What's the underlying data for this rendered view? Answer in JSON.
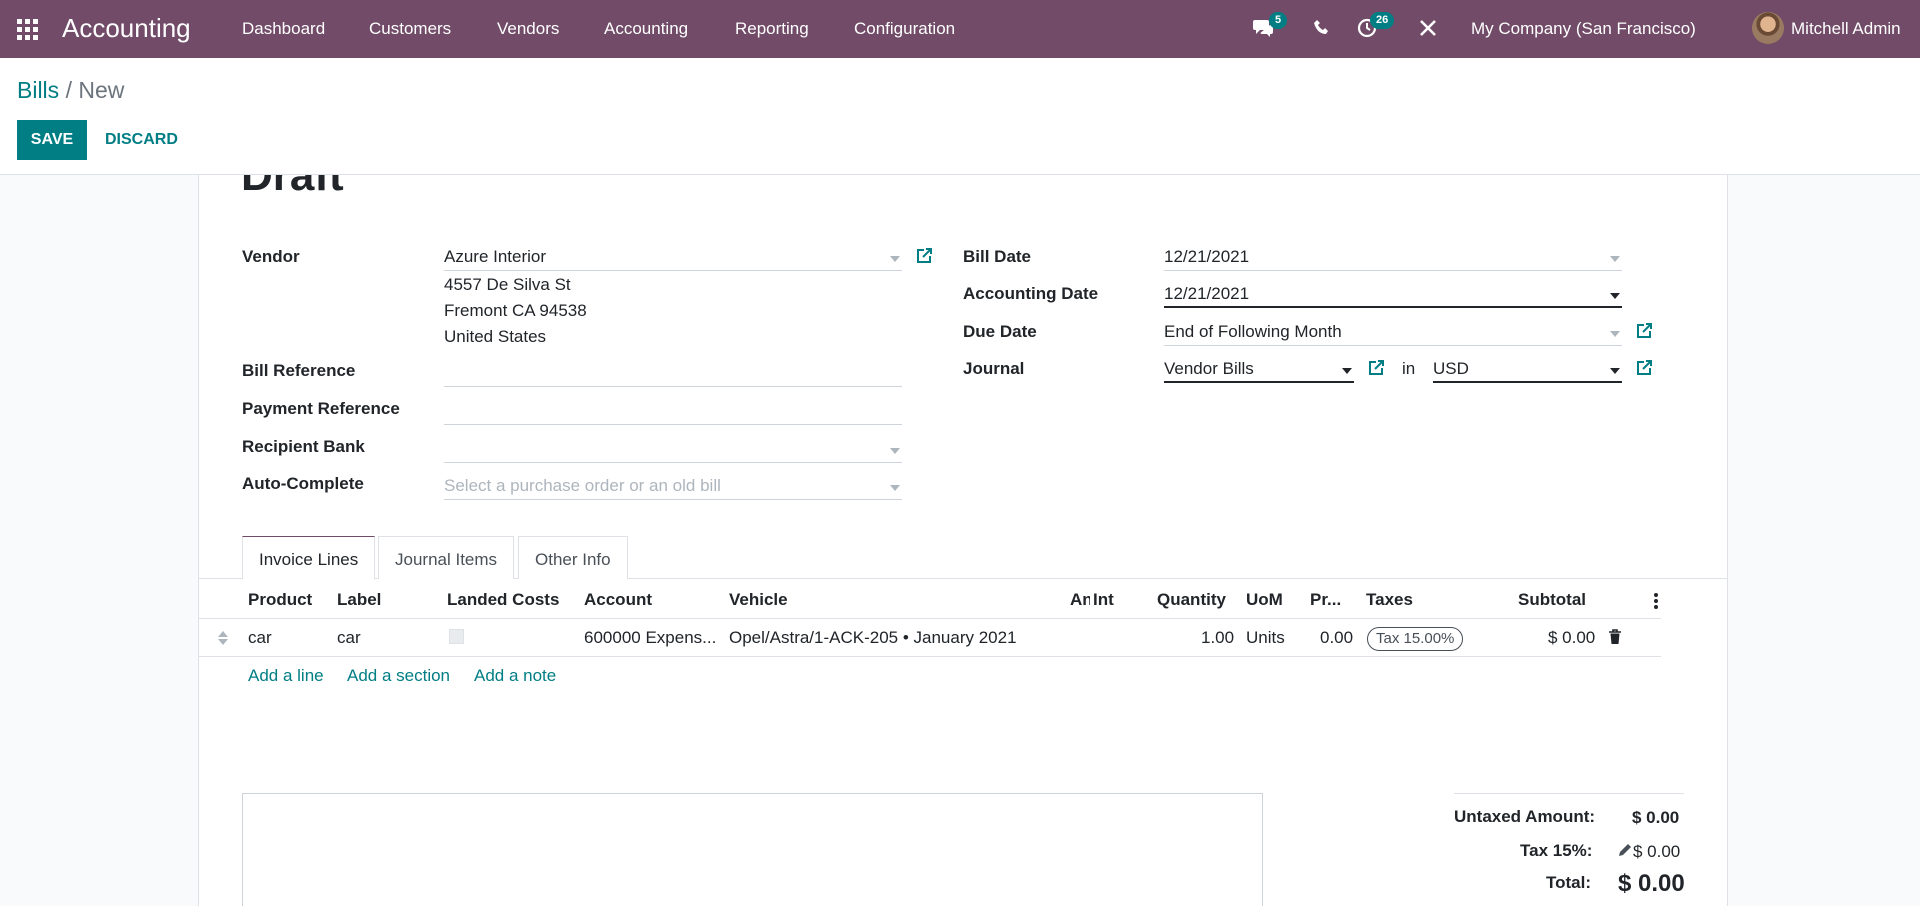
{
  "navbar": {
    "app_name": "Accounting",
    "menu": [
      "Dashboard",
      "Customers",
      "Vendors",
      "Accounting",
      "Reporting",
      "Configuration"
    ],
    "messages_count": "5",
    "activities_count": "26",
    "company": "My Company (San Francisco)",
    "user": "Mitchell Admin"
  },
  "breadcrumb": {
    "parent": "Bills",
    "separator": "/",
    "current": "New"
  },
  "buttons": {
    "save": "SAVE",
    "discard": "DISCARD"
  },
  "form": {
    "status": "Draft",
    "vendor_label": "Vendor",
    "vendor_value": "Azure Interior",
    "vendor_address": [
      "4557 De Silva St",
      "Fremont CA 94538",
      "United States"
    ],
    "bill_reference_label": "Bill Reference",
    "payment_reference_label": "Payment Reference",
    "recipient_bank_label": "Recipient Bank",
    "auto_complete_label": "Auto-Complete",
    "auto_complete_placeholder": "Select a purchase order or an old bill",
    "bill_date_label": "Bill Date",
    "bill_date_value": "12/21/2021",
    "accounting_date_label": "Accounting Date",
    "accounting_date_value": "12/21/2021",
    "due_date_label": "Due Date",
    "due_date_value": "End of Following Month",
    "journal_label": "Journal",
    "journal_value": "Vendor Bills",
    "journal_in": "in",
    "currency_value": "USD"
  },
  "tabs": [
    "Invoice Lines",
    "Journal Items",
    "Other Info"
  ],
  "table": {
    "columns": [
      "Product",
      "Label",
      "Landed Costs",
      "Account",
      "Vehicle",
      "An",
      "Int",
      "Quantity",
      "UoM",
      "Pr...",
      "Taxes",
      "Subtotal"
    ],
    "rows": [
      {
        "product": "car",
        "label": "car",
        "landed_costs": false,
        "account": "600000 Expens...",
        "vehicle": "Opel/Astra/1-ACK-205 • January 2021",
        "quantity": "1.00",
        "uom": "Units",
        "price": "0.00",
        "tax": "Tax 15.00%",
        "subtotal": "$ 0.00"
      }
    ],
    "add_line": "Add a line",
    "add_section": "Add a section",
    "add_note": "Add a note"
  },
  "totals": {
    "untaxed_label": "Untaxed Amount:",
    "untaxed_value": "$ 0.00",
    "tax_label": "Tax 15%:",
    "tax_value": "$ 0.00",
    "total_label": "Total:",
    "total_value": "$ 0.00"
  },
  "colors": {
    "brand": "#714b67",
    "accent": "#017e84",
    "badge": "#017e84"
  }
}
